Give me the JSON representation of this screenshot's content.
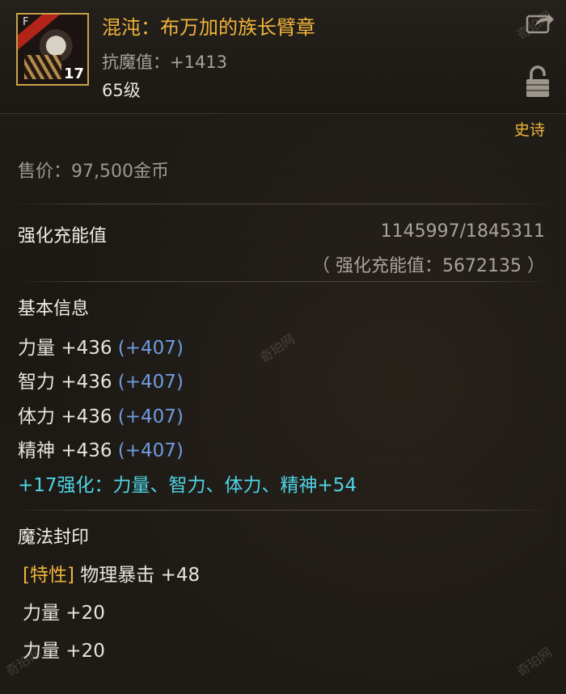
{
  "item": {
    "name": "混沌：布万加的族长臂章",
    "sub_stat_label": "抗魔值：",
    "sub_stat_value": "+1413",
    "level": "65级",
    "icon_grade": "F",
    "icon_enhance": "17",
    "rarity": "史诗"
  },
  "price": {
    "label": "售价：",
    "value": "97,500金币"
  },
  "charge": {
    "label": "强化充能值",
    "value": "1145997/1845311",
    "total": "（ 强化充能值：5672135 ）"
  },
  "basic_info": {
    "title": "基本信息",
    "stats": [
      {
        "name": "力量",
        "value": "+436",
        "bonus": "(+407)"
      },
      {
        "name": "智力",
        "value": "+436",
        "bonus": "(+407)"
      },
      {
        "name": "体力",
        "value": "+436",
        "bonus": "(+407)"
      },
      {
        "name": "精神",
        "value": "+436",
        "bonus": "(+407)"
      }
    ],
    "enhance_line": "+17强化：力量、智力、体力、精神+54"
  },
  "magic_seal": {
    "title": "魔法封印",
    "rows": [
      {
        "tag": "[特性]",
        "text": " 物理暴击 +48"
      },
      {
        "tag": "",
        "text": "力量 +20"
      },
      {
        "tag": "",
        "text": "力量 +20"
      }
    ]
  },
  "watermark": "奇珀网",
  "colors": {
    "gold": "#f0b43a",
    "blue_bonus": "#6f9be0",
    "cyan_enhance": "#4fd4e4",
    "gray_text": "#a8a39a"
  },
  "icons": {
    "share": "share-arrow-icon",
    "lock": "padlock-icon"
  }
}
